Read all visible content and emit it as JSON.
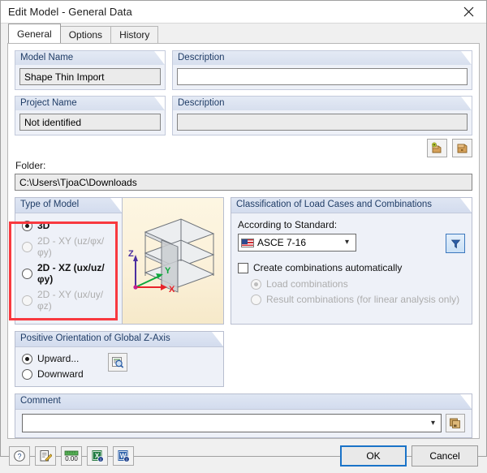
{
  "window": {
    "title": "Edit Model - General Data",
    "close_icon": "close-icon"
  },
  "tabs": [
    {
      "label": "General",
      "active": true
    },
    {
      "label": "Options",
      "active": false
    },
    {
      "label": "History",
      "active": false
    }
  ],
  "model_name_section": {
    "name_header": "Model Name",
    "name_value": "Shape Thin Import",
    "description_header": "Description",
    "description_value": ""
  },
  "project_section": {
    "name_header": "Project Name",
    "name_value": "Not identified",
    "description_header": "Description",
    "description_value": "",
    "new_folder_icon": "add-folder-icon",
    "browse_folder_icon": "folder-icon"
  },
  "folder_section": {
    "label": "Folder:",
    "value": "C:\\Users\\TjoaC\\Downloads"
  },
  "type_of_model": {
    "header": "Type of Model",
    "options": [
      {
        "label": "3D",
        "selected": true,
        "enabled": true,
        "bold": true
      },
      {
        "label": "2D - XY (uz/φx/φy)",
        "selected": false,
        "enabled": false,
        "bold": false
      },
      {
        "label": "2D - XZ (ux/uz/φy)",
        "selected": false,
        "enabled": true,
        "bold": true
      },
      {
        "label": "2D - XY (ux/uy/φz)",
        "selected": false,
        "enabled": false,
        "bold": false
      }
    ]
  },
  "preview": {
    "axis_x": "X",
    "axis_y": "Y",
    "axis_z": "Z"
  },
  "classification": {
    "header": "Classification of Load Cases and Combinations",
    "standard_label": "According to Standard:",
    "standard_value": "ASCE 7-16",
    "standard_flag_icon": "us-flag-icon",
    "dropdown_icon": "chevron-down-icon",
    "filter_icon": "filter-icon",
    "auto_combinations_label": "Create combinations automatically",
    "auto_combinations_checked": false,
    "sub_options": [
      {
        "label": "Load combinations",
        "selected": true,
        "enabled": false
      },
      {
        "label": "Result combinations (for linear analysis only)",
        "selected": false,
        "enabled": false
      }
    ]
  },
  "z_axis": {
    "header": "Positive Orientation of Global Z-Axis",
    "options": [
      {
        "label": "Upward...",
        "selected": true
      },
      {
        "label": "Downward",
        "selected": false
      }
    ],
    "preview_icon": "magnifier-preview-icon"
  },
  "comment": {
    "header": "Comment",
    "value": "",
    "dropdown_icon": "chevron-down-icon",
    "copy_icon": "copy-comment-icon"
  },
  "footer": {
    "tools": [
      {
        "name": "help-icon",
        "glyph": "?"
      },
      {
        "name": "edit-note-icon",
        "glyph": "edit"
      },
      {
        "name": "units-icon",
        "glyph": "0.00"
      },
      {
        "name": "excel-export-icon",
        "glyph": "X"
      },
      {
        "name": "word-export-icon",
        "glyph": "W"
      }
    ],
    "ok_label": "OK",
    "cancel_label": "Cancel"
  },
  "annotation": {
    "color": "#f8393f"
  }
}
